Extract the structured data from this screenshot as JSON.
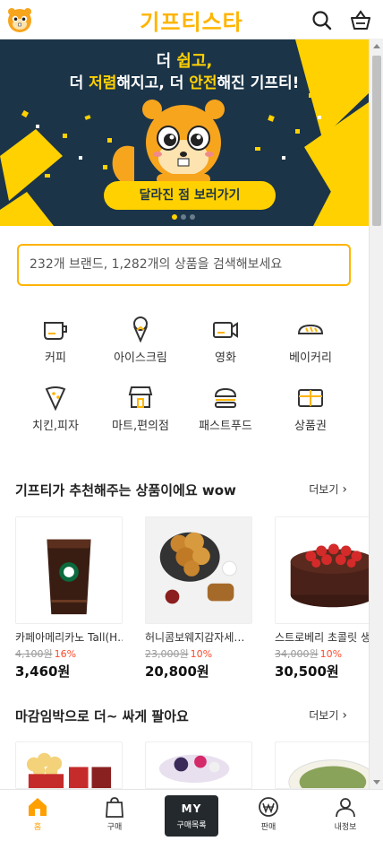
{
  "header": {
    "brand": "기프티스타",
    "search_icon": "search-icon",
    "cart_icon": "basket-icon"
  },
  "banner": {
    "line1_a": "더 ",
    "line1_b": "쉽고,",
    "line2_a": "더 ",
    "line2_b": "저렴",
    "line2_c": "해지고, 더 ",
    "line2_d": "안전",
    "line2_e": "해진 기프티!",
    "cta": "달라진 점 보러가기",
    "colors": {
      "bg": "#1b3448",
      "accent": "#ffd100"
    }
  },
  "search": {
    "placeholder": "232개 브랜드, 1,282개의 상품을 검색해보세요"
  },
  "categories": [
    {
      "label": "커피",
      "icon": "coffee-cup-icon"
    },
    {
      "label": "아이스크림",
      "icon": "ice-cream-icon"
    },
    {
      "label": "영화",
      "icon": "video-camera-icon"
    },
    {
      "label": "베이커리",
      "icon": "bread-icon"
    },
    {
      "label": "치킨,피자",
      "icon": "pizza-icon"
    },
    {
      "label": "마트,편의점",
      "icon": "store-icon"
    },
    {
      "label": "패스트푸드",
      "icon": "burger-icon"
    },
    {
      "label": "상품권",
      "icon": "gift-card-icon"
    }
  ],
  "recommended": {
    "title": "기프티가 추천해주는 상품이에요 wow",
    "more": "더보기",
    "products": [
      {
        "name": "카페아메리카노 Tall(H…",
        "orig": "4,100원",
        "discount": "16%",
        "price": "3,460원"
      },
      {
        "name": "허니콤보웨지감자세…",
        "orig": "23,000원",
        "discount": "10%",
        "price": "20,800원"
      },
      {
        "name": "스트로베리 초콜릿 생",
        "orig": "34,000원",
        "discount": "10%",
        "price": "30,500원"
      }
    ]
  },
  "deadline": {
    "title": "마감임박으로 더~ 싸게 팔아요",
    "more": "더보기"
  },
  "bottom_nav": {
    "items": [
      {
        "label": "홈",
        "icon": "home-icon"
      },
      {
        "label": "구매",
        "icon": "shopping-bag-icon"
      },
      {
        "label": "구매목록",
        "icon": "my-list-icon",
        "badge": "MY"
      },
      {
        "label": "판매",
        "icon": "won-coin-icon"
      },
      {
        "label": "내정보",
        "icon": "user-icon"
      }
    ],
    "active_color": "#ff9f00"
  }
}
